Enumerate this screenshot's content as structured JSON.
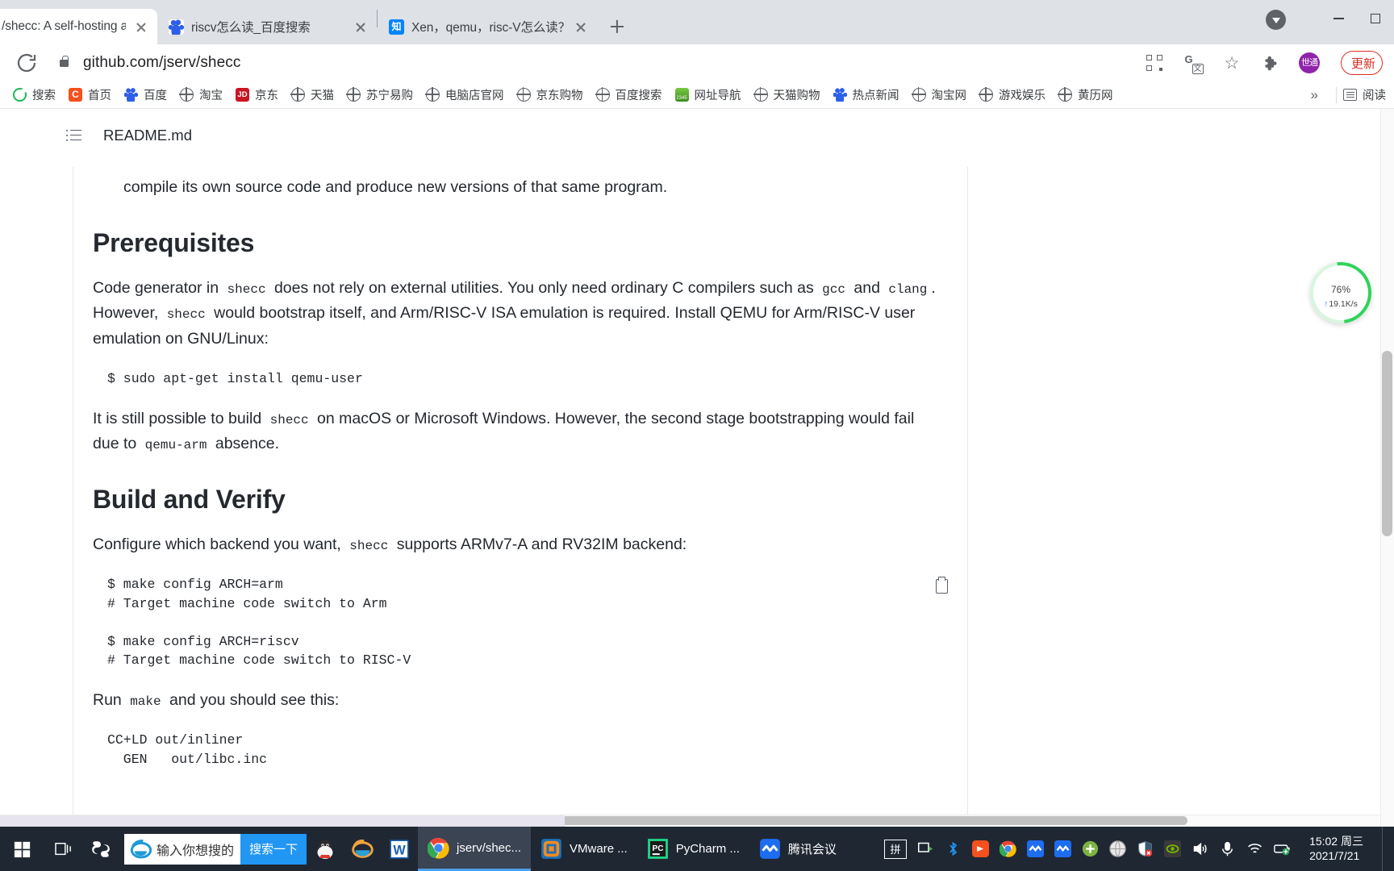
{
  "browser": {
    "tabs": [
      {
        "title": "/shecc: A self-hosting and",
        "favicon": "github-icon",
        "active": true
      },
      {
        "title": "riscv怎么读_百度搜索",
        "favicon": "baidu-icon",
        "active": false
      },
      {
        "title": "Xen，qemu，risc-V怎么读？- 知",
        "favicon": "zhihu-icon",
        "active": false
      }
    ],
    "new_tab_label": "+",
    "window_controls": {
      "minimize": "−",
      "maximize": "□"
    },
    "omnibox": {
      "url": "github.com/jserv/shecc",
      "reload_icon": "reload-icon",
      "lock_icon": "lock-icon",
      "qr_icon": "qr-code-icon",
      "translate_icon": "translate-icon",
      "bookmark_icon": "star-icon",
      "extensions_icon": "puzzle-piece-icon",
      "profile_initials": "世通",
      "update_label": "更新"
    },
    "bookmarks": [
      {
        "label": "搜索",
        "icon": "360-search-icon"
      },
      {
        "label": "首页",
        "icon": "chrome-home-icon"
      },
      {
        "label": "百度",
        "icon": "baidu-icon"
      },
      {
        "label": "淘宝",
        "icon": "globe-icon"
      },
      {
        "label": "京东",
        "icon": "jd-icon"
      },
      {
        "label": "天猫",
        "icon": "globe-icon"
      },
      {
        "label": "苏宁易购",
        "icon": "globe-icon"
      },
      {
        "label": "电脑店官网",
        "icon": "globe-icon"
      },
      {
        "label": "京东购物",
        "icon": "globe-icon"
      },
      {
        "label": "百度搜索",
        "icon": "globe-icon"
      },
      {
        "label": "网址导航",
        "icon": "2345-nav-icon"
      },
      {
        "label": "天猫购物",
        "icon": "globe-icon"
      },
      {
        "label": "热点新闻",
        "icon": "baidu-icon"
      },
      {
        "label": "淘宝网",
        "icon": "globe-icon"
      },
      {
        "label": "游戏娱乐",
        "icon": "globe-icon"
      },
      {
        "label": "黄历网",
        "icon": "globe-icon"
      }
    ],
    "bookmarks_overflow": "»",
    "reading_mode_label": "阅读"
  },
  "page": {
    "file_header": {
      "icon": "list-outline-icon",
      "filename": "README.md"
    },
    "paragraph_top": "compile its own source code and produce new versions of that same program.",
    "sections": [
      {
        "heading": "Prerequisites",
        "paragraph_1_parts": [
          "Code generator in ",
          "shecc",
          " does not rely on external utilities. You only need ordinary C compilers such as ",
          "gcc",
          " and ",
          "clang",
          ". However, ",
          "shecc",
          " would bootstrap itself, and Arm/RISC-V ISA emulation is required. Install QEMU for Arm/RISC-V user emulation on GNU/Linux:"
        ],
        "code_1": "$ sudo apt-get install qemu-user",
        "paragraph_2_parts": [
          "It is still possible to build ",
          "shecc",
          " on macOS or Microsoft Windows. However, the second stage bootstrapping would fail due to ",
          "qemu-arm",
          " absence."
        ]
      },
      {
        "heading": "Build and Verify",
        "paragraph_1_parts": [
          "Configure which backend you want, ",
          "shecc",
          " supports ARMv7-A and RV32IM backend:"
        ],
        "code_1": "$ make config ARCH=arm\n# Target machine code switch to Arm\n\n$ make config ARCH=riscv\n# Target machine code switch to RISC-V",
        "copy_icon": "copy-to-clipboard-icon",
        "paragraph_2_parts": [
          "Run ",
          "make",
          " and you should see this:"
        ],
        "code_2": "CC+LD out/inliner\n  GEN   out/libc.inc"
      }
    ]
  },
  "speed_widget": {
    "percent": "76",
    "percent_symbol": "%",
    "rate": "19.1K/s"
  },
  "taskbar": {
    "start_icon": "windows-start-icon",
    "taskview_icon": "task-view-icon",
    "sogou_icon": "sogou-icon",
    "search": {
      "icon": "ie-browser-icon",
      "placeholder": "输入你想搜的",
      "button_label": "搜索一下"
    },
    "pinned": [
      {
        "label": "",
        "icon": "qq-penguin-icon"
      },
      {
        "label": "",
        "icon": "internet-explorer-icon"
      },
      {
        "label": "",
        "icon": "word-icon"
      }
    ],
    "windows": [
      {
        "label": "jserv/shec...",
        "icon": "chrome-icon",
        "active": true
      },
      {
        "label": "VMware ...",
        "icon": "vmware-icon",
        "active": false
      },
      {
        "label": "PyCharm ...",
        "icon": "pycharm-icon",
        "active": false
      },
      {
        "label": "腾讯会议",
        "icon": "tencent-meeting-icon",
        "active": false
      }
    ],
    "tray": {
      "ime_label": "拼",
      "icons": [
        "screen-cast-icon",
        "bluetooth-icon",
        "media-icon",
        "chrome-icon",
        "tencent-meeting-icon",
        "tencent-meeting-icon",
        "update-icon",
        "globe-icon",
        "security-shield-icon",
        "nvidia-icon",
        "volume-icon",
        "microphone-icon",
        "wifi-icon",
        "battery-saver-icon"
      ]
    },
    "clock": {
      "time": "15:02 周三",
      "date": "2021/7/21"
    }
  }
}
